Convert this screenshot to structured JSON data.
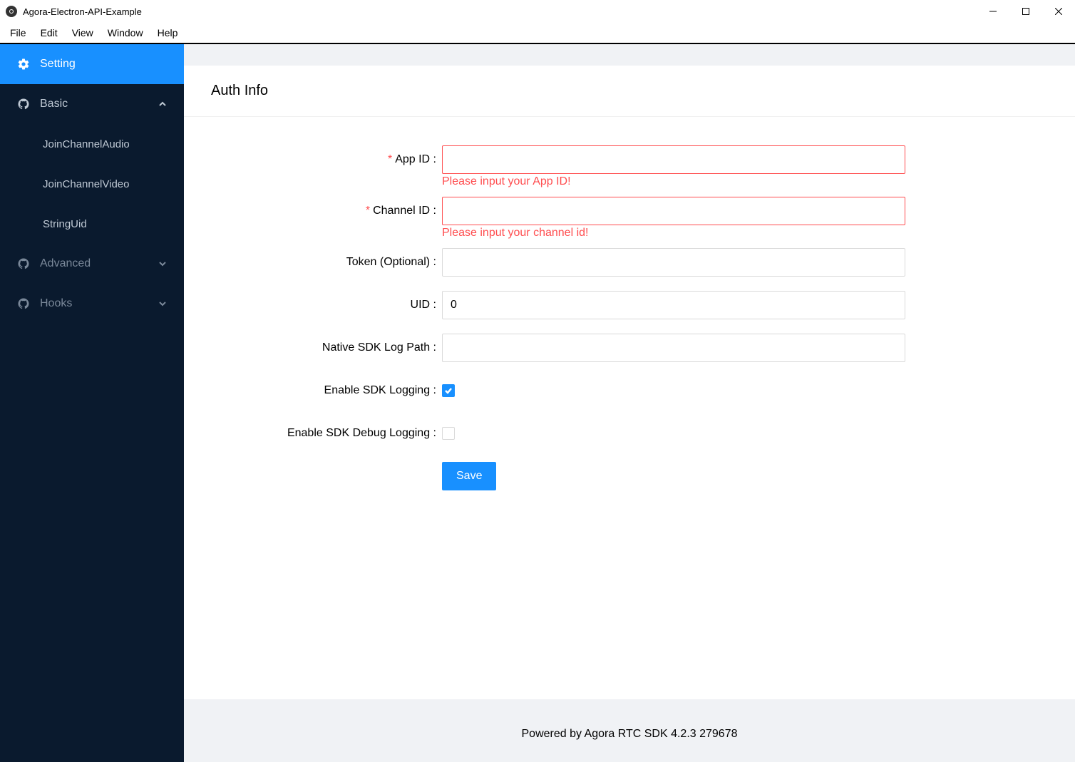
{
  "window": {
    "title": "Agora-Electron-API-Example"
  },
  "menubar": [
    "File",
    "Edit",
    "View",
    "Window",
    "Help"
  ],
  "sidebar": {
    "setting_label": "Setting",
    "groups": [
      {
        "label": "Basic",
        "expanded": true,
        "items": [
          "JoinChannelAudio",
          "JoinChannelVideo",
          "StringUid"
        ]
      },
      {
        "label": "Advanced",
        "expanded": false
      },
      {
        "label": "Hooks",
        "expanded": false
      }
    ]
  },
  "page": {
    "title": "Auth Info",
    "fields": {
      "app_id": {
        "label": "App ID",
        "required": true,
        "value": "",
        "error": "Please input your App ID!"
      },
      "channel_id": {
        "label": "Channel ID",
        "required": true,
        "value": "",
        "error": "Please input your channel id!"
      },
      "token": {
        "label": "Token (Optional)",
        "required": false,
        "value": ""
      },
      "uid": {
        "label": "UID",
        "required": false,
        "value": "0"
      },
      "log_path": {
        "label": "Native SDK Log Path",
        "required": false,
        "value": ""
      },
      "enable_logging": {
        "label": "Enable SDK Logging",
        "checked": true
      },
      "enable_debug_logging": {
        "label": "Enable SDK Debug Logging",
        "checked": false
      }
    },
    "save_label": "Save"
  },
  "footer": "Powered by Agora RTC SDK 4.2.3 279678",
  "colors": {
    "accent": "#1890ff",
    "sidebar_bg": "#0a1a2e",
    "error": "#ff4d4f"
  }
}
